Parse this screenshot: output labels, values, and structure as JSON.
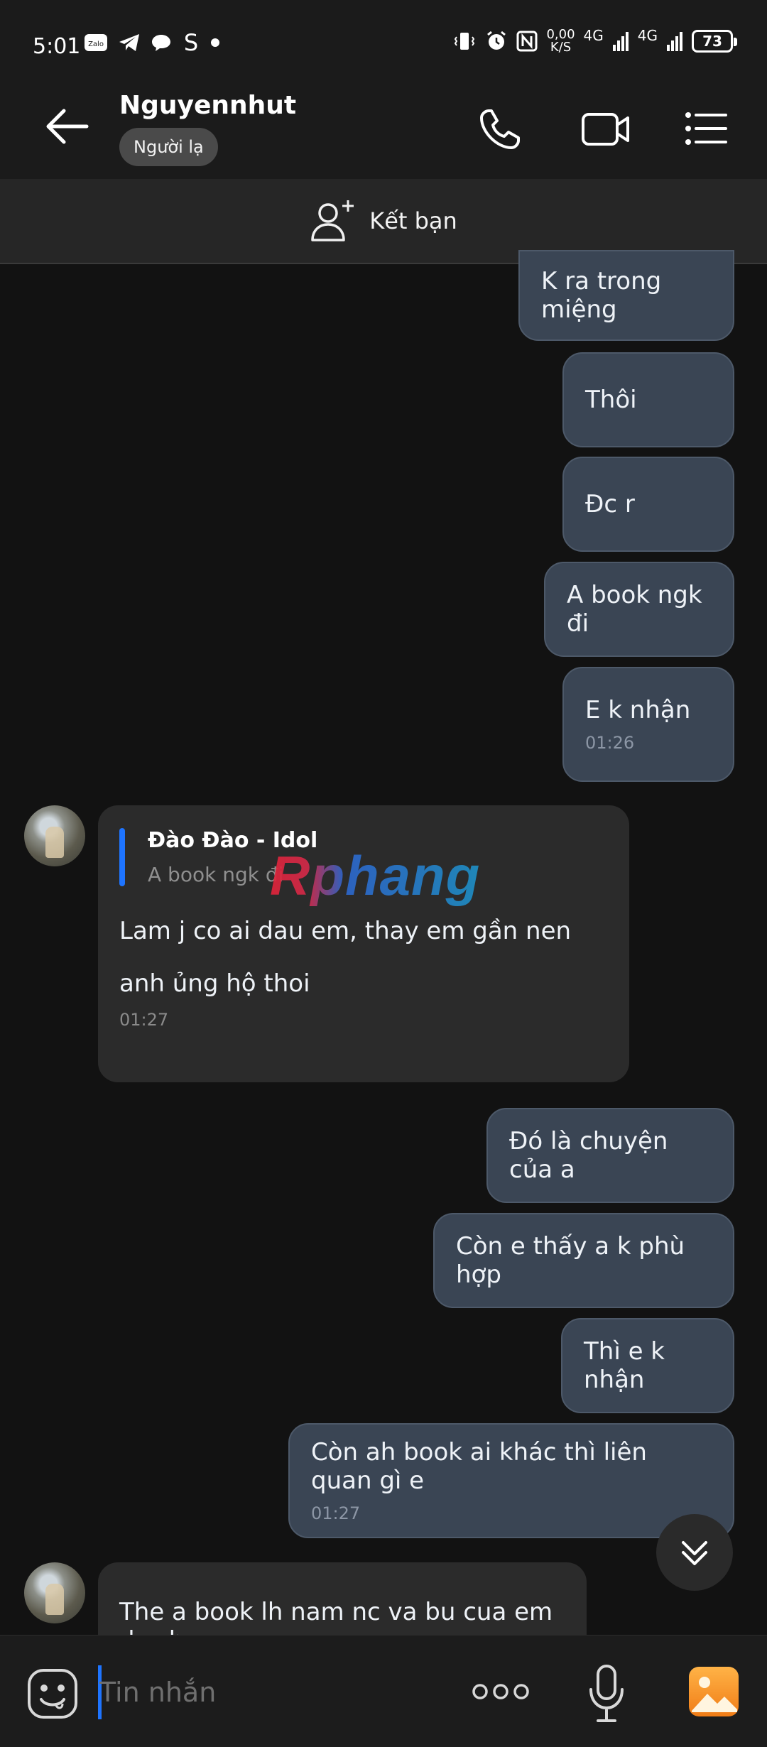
{
  "status_bar": {
    "time": "5:01",
    "left_icons": [
      "zalo-icon",
      "telegram-icon",
      "chat-bubble-icon",
      "s-app-icon",
      "dot-icon"
    ],
    "net_speed_value": "0,00",
    "net_speed_unit": "K/S",
    "network_1": "4G",
    "network_2": "4G",
    "battery": "73"
  },
  "header": {
    "contact_name": "Nguyennhut",
    "badge": "Người lạ",
    "icons": [
      "back-arrow-icon",
      "phone-icon",
      "video-call-icon",
      "menu-list-icon"
    ]
  },
  "add_friend": {
    "label": "Kết bạn",
    "icon": "add-user-icon"
  },
  "messages": [
    {
      "dir": "out",
      "text": "K ra trong miệng"
    },
    {
      "dir": "out",
      "text": "Thôi"
    },
    {
      "dir": "out",
      "text": "Đc r"
    },
    {
      "dir": "out",
      "text": "A book ngk đi"
    },
    {
      "dir": "out",
      "text": "E k nhận",
      "time": "01:26"
    },
    {
      "dir": "in",
      "quote_title": "Đào Đào - Idol",
      "quote_text": "A book ngk đi",
      "text": "Lam j co ai dau em, thay em gần nen anh ủng hộ thoi",
      "time": "01:27"
    },
    {
      "dir": "out",
      "text": "Đó là chuyện của a"
    },
    {
      "dir": "out",
      "text": "Còn e thấy a k phù hợp"
    },
    {
      "dir": "out",
      "text": "Thì e k nhận"
    },
    {
      "dir": "out",
      "text": "Còn ah book ai khác thì liên quan gì e",
      "time": "01:27"
    },
    {
      "dir": "in",
      "text": "The a book lh nam nc va bu cua em dc chu"
    }
  ],
  "watermark": "Rphang",
  "input_bar": {
    "placeholder": "Tin nhắn",
    "icons": [
      "emoji-icon",
      "more-dots-icon",
      "microphone-icon",
      "image-gallery-icon"
    ]
  },
  "colors": {
    "background": "#121212",
    "outgoing_bubble": "#3a4554",
    "incoming_bubble": "#2b2b2b",
    "accent": "#1e74ff"
  }
}
